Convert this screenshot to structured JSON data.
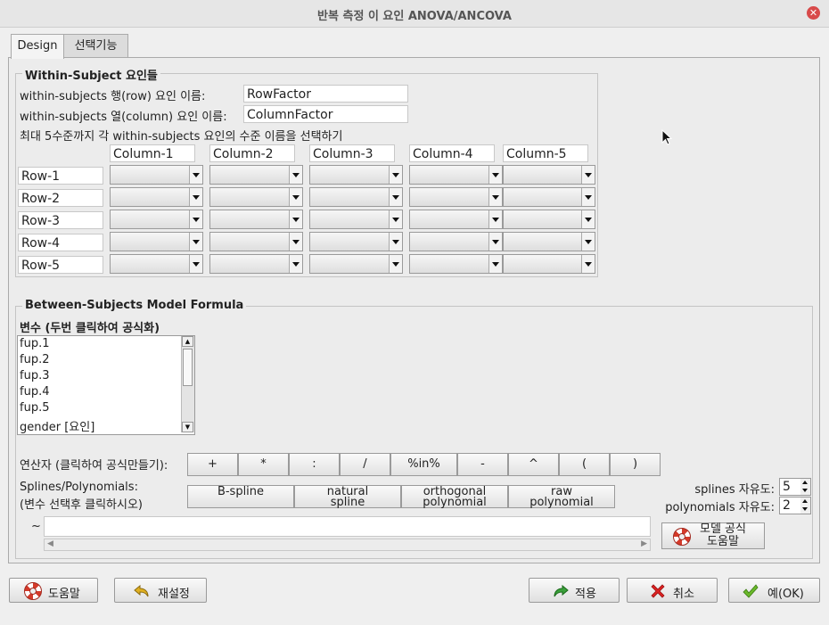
{
  "window": {
    "title": "반복 측정 이 요인 ANOVA/ANCOVA"
  },
  "tabs": [
    {
      "label": "Design"
    },
    {
      "label": "선택기능"
    }
  ],
  "within": {
    "title": "Within-Subject 요인들",
    "row_name_label": "within-subjects 행(row) 요인 이름:",
    "row_name_value": "RowFactor",
    "col_name_label": "within-subjects 열(column) 요인 이름:",
    "col_name_value": "ColumnFactor",
    "levels_label": "최대 5수준까지 각 within-subjects 요인의 수준 이름을 선택하기",
    "columns": [
      "Column-1",
      "Column-2",
      "Column-3",
      "Column-4",
      "Column-5"
    ],
    "rows": [
      "Row-1",
      "Row-2",
      "Row-3",
      "Row-4",
      "Row-5"
    ]
  },
  "between": {
    "title": "Between-Subjects Model Formula",
    "variables_label": "변수 (두번 클릭하여 공식화)",
    "variables": [
      "fup.1",
      "fup.2",
      "fup.3",
      "fup.4",
      "fup.5",
      "gender [요인]"
    ],
    "operators_label": "연산자 (클릭하여 공식만들기):",
    "operators": [
      "+",
      "*",
      ":",
      "/",
      "%in%",
      "-",
      "^",
      "(",
      ")"
    ],
    "splines_label_1": "Splines/Polynomials:",
    "splines_label_2": "(변수 선택후 클릭하시오)",
    "spline_buttons": [
      {
        "line1": "B-spline",
        "line2": ""
      },
      {
        "line1": "natural",
        "line2": "spline"
      },
      {
        "line1": "orthogonal",
        "line2": "polynomial"
      },
      {
        "line1": "raw",
        "line2": "polynomial"
      }
    ],
    "splines_df_label": "splines 자유도:",
    "splines_df_value": "5",
    "poly_df_label": "polynomials 자유도:",
    "poly_df_value": "2",
    "tilde": "~",
    "formula_value": "",
    "formula_help_line1": "모델 공식",
    "formula_help_line2": "도움말"
  },
  "buttons": {
    "help": "도움말",
    "reset": "재설정",
    "apply": "적용",
    "cancel": "취소",
    "ok": "예(OK)"
  },
  "icons": {
    "help": "lifebuoy-icon",
    "reset": "undo-arrow-icon",
    "apply": "redo-arrow-icon",
    "cancel": "red-x-icon",
    "ok": "green-check-icon"
  }
}
